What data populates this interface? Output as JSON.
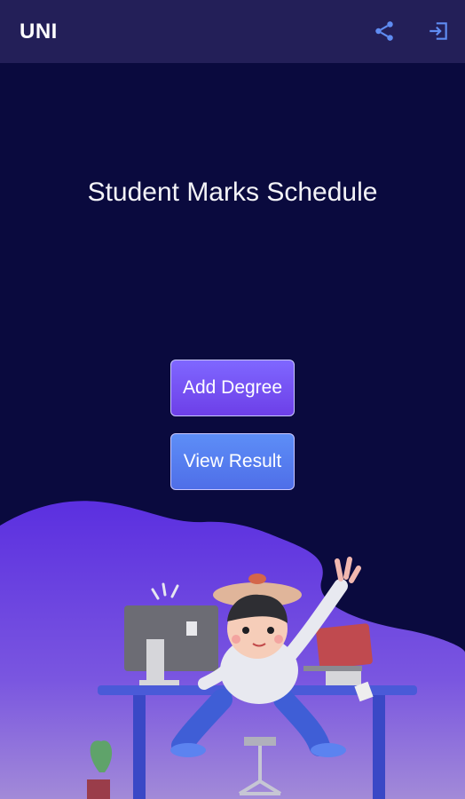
{
  "appbar": {
    "title": "UNI",
    "share_icon": "share-icon",
    "logout_icon": "logout-icon"
  },
  "main": {
    "headline": "Student Marks Schedule",
    "add_degree_label": "Add Degree",
    "view_result_label": "View Result"
  },
  "colors": {
    "background": "#0a0a3e",
    "appbar": "#231f58",
    "accent_purple": "#6d3fe8",
    "accent_blue": "#4f6ee8"
  }
}
